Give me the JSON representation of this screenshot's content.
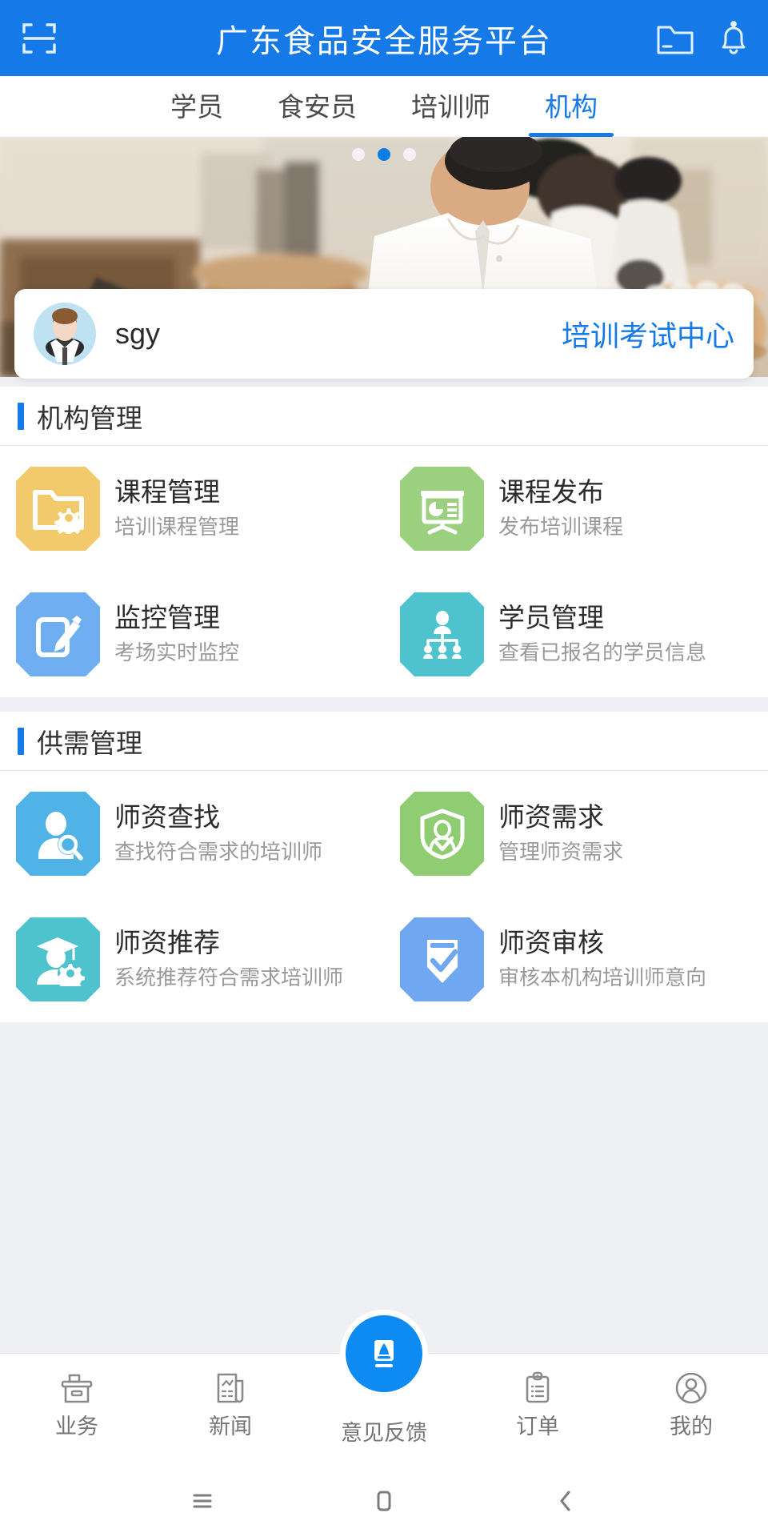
{
  "header": {
    "title": "广东食品安全服务平台",
    "left_icon": "scan-icon",
    "right_icons": [
      "folder-icon",
      "bell-icon"
    ],
    "background_color": "#1579E8"
  },
  "tabs": {
    "items": [
      {
        "label": "学员",
        "active": false
      },
      {
        "label": "食安员",
        "active": false
      },
      {
        "label": "培训师",
        "active": false
      },
      {
        "label": "机构",
        "active": true
      }
    ],
    "active_color": "#1579E8",
    "inactive_color": "#4a4a4a"
  },
  "banner": {
    "alt": "restaurant-kitchen-photo",
    "dots": {
      "count": 3,
      "active_index": 1,
      "active_color": "#0b7ce8"
    }
  },
  "profile": {
    "avatar": "user-avatar",
    "username": "sgy",
    "organization": "培训考试中心",
    "organization_color": "#1579E8"
  },
  "sections": [
    {
      "title": "机构管理",
      "items": [
        {
          "title": "课程管理",
          "subtitle": "培训课程管理",
          "icon": "folder-gear-icon",
          "color": "#F2C96B"
        },
        {
          "title": "课程发布",
          "subtitle": "发布培训课程",
          "icon": "presentation-chart-icon",
          "color": "#9BD17E"
        },
        {
          "title": "监控管理",
          "subtitle": "考场实时监控",
          "icon": "pencil-edit-icon",
          "color": "#6FAEF0"
        },
        {
          "title": "学员管理",
          "subtitle": "查看已报名的学员信息",
          "icon": "org-chart-icon",
          "color": "#4FC3CD"
        }
      ]
    },
    {
      "title": "供需管理",
      "items": [
        {
          "title": "师资查找",
          "subtitle": "查找符合需求的培训师",
          "icon": "person-search-icon",
          "color": "#4FB3E8"
        },
        {
          "title": "师资需求",
          "subtitle": "管理师资需求",
          "icon": "shield-person-icon",
          "color": "#8FCC72"
        },
        {
          "title": "师资推荐",
          "subtitle": "系统推荐符合需求培训师",
          "icon": "graduate-gear-icon",
          "color": "#4FC3CD"
        },
        {
          "title": "师资审核",
          "subtitle": "审核本机构培训师意向",
          "icon": "shield-check-icon",
          "color": "#6FA8F0"
        }
      ]
    }
  ],
  "bottom_nav": {
    "items": [
      {
        "label": "业务",
        "icon": "briefcase-icon",
        "active": false
      },
      {
        "label": "新闻",
        "icon": "news-document-icon",
        "active": false
      },
      {
        "label": "意见反馈",
        "icon": "feedback-icon",
        "active": true
      },
      {
        "label": "订单",
        "icon": "clipboard-list-icon",
        "active": false
      },
      {
        "label": "我的",
        "icon": "person-circle-icon",
        "active": false
      }
    ],
    "active_color": "#0d8bf2"
  },
  "system_nav": {
    "buttons": [
      {
        "name": "menu-button",
        "icon": "hamburger-icon"
      },
      {
        "name": "home-button",
        "icon": "square-icon"
      },
      {
        "name": "back-button",
        "icon": "chevron-left-icon"
      }
    ]
  }
}
